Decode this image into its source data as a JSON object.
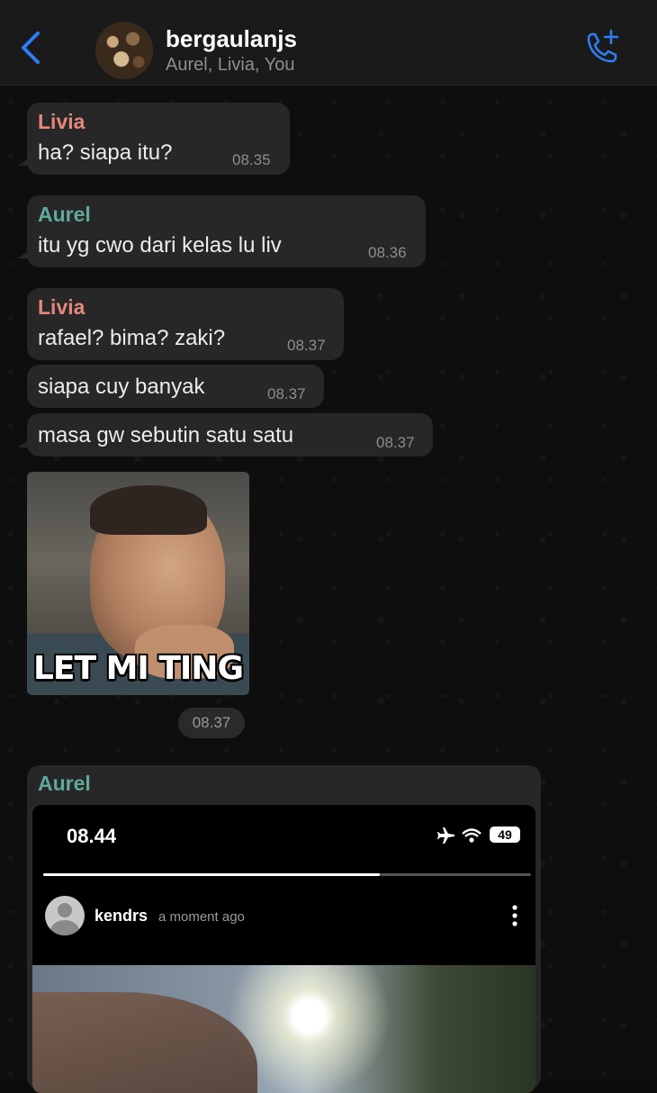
{
  "header": {
    "title": "bergaulanjs",
    "subtitle": "Aurel, Livia, You"
  },
  "messages": [
    {
      "sender": "Livia",
      "text": "ha? siapa itu?",
      "time": "08.35"
    },
    {
      "sender": "Aurel",
      "text": "itu yg cwo dari kelas lu liv",
      "time": "08.36"
    },
    {
      "sender": "Livia",
      "text": "rafael? bima? zaki?",
      "time": "08.37"
    },
    {
      "sender": "",
      "text": "siapa cuy banyak",
      "time": "08.37"
    },
    {
      "sender": "",
      "text": "masa gw sebutin satu satu",
      "time": "08.37"
    }
  ],
  "meme": {
    "caption": "LET MI TING",
    "time": "08.37"
  },
  "screenshot_message": {
    "sender": "Aurel",
    "status_time": "08.44",
    "battery": "49",
    "story_progress": 0.69,
    "username": "kendrs",
    "posted": "a moment ago"
  },
  "colors": {
    "accent": "#2f7df6",
    "livia": "#e5877b",
    "aurel": "#5fa99a",
    "bubble": "#272727"
  }
}
